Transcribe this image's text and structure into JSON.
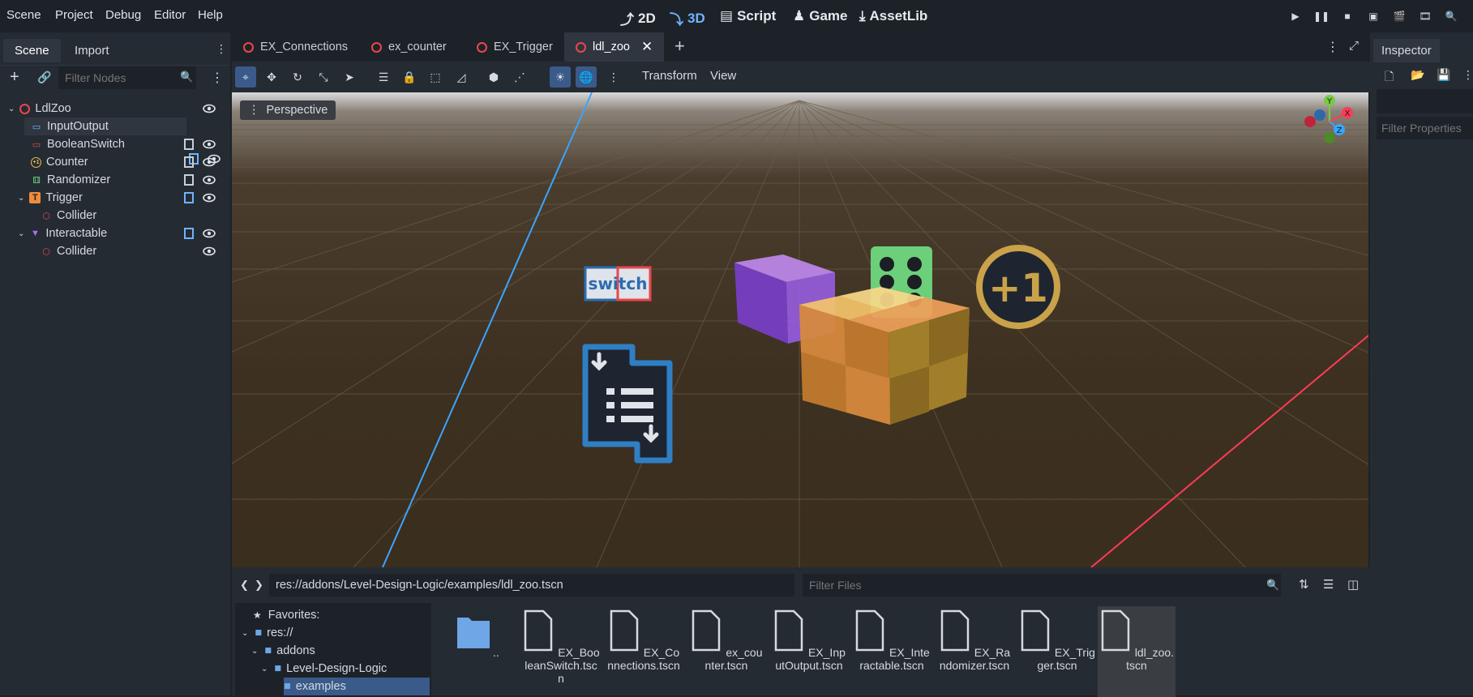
{
  "menu": [
    "Scene",
    "Project",
    "Debug",
    "Editor",
    "Help"
  ],
  "workspaces": [
    {
      "label": "2D",
      "active": false
    },
    {
      "label": "3D",
      "active": true
    },
    {
      "label": "Script",
      "active": false
    },
    {
      "label": "Game",
      "active": false
    },
    {
      "label": "AssetLib",
      "active": false
    }
  ],
  "left_dock": {
    "tabs": [
      "Scene",
      "Import"
    ],
    "filter_placeholder": "Filter Nodes",
    "tree": [
      {
        "label": "LdlZoo",
        "icon": "node3d-icon",
        "color": "#e9474c"
      },
      {
        "label": "InputOutput",
        "icon": "input-output-icon",
        "color": "#6fb4ff"
      },
      {
        "label": "BooleanSwitch",
        "icon": "boolean-switch-icon",
        "color": "#e9474c"
      },
      {
        "label": "Counter",
        "icon": "counter-icon",
        "color": "#e8c14b"
      },
      {
        "label": "Randomizer",
        "icon": "randomizer-icon",
        "color": "#6ccf7a"
      },
      {
        "label": "Trigger",
        "icon": "trigger-icon",
        "color": "#f08b3c"
      },
      {
        "label": "Collider",
        "icon": "collider-icon",
        "color": "#e9474c"
      },
      {
        "label": "Interactable",
        "icon": "interactable-icon",
        "color": "#b46cf0"
      },
      {
        "label": "Collider",
        "icon": "collider-icon",
        "color": "#e9474c"
      }
    ]
  },
  "scene_tabs": [
    "EX_Connections",
    "ex_counter",
    "EX_Trigger",
    "ldl_zoo"
  ],
  "toolbar": {
    "transform_label": "Transform",
    "view_label": "View"
  },
  "viewport": {
    "perspective_label": "Perspective",
    "gizmo_labels": [
      "Y",
      "X",
      "Z"
    ],
    "switch_text": "switch",
    "plus_one_text": "+1"
  },
  "filesystem": {
    "path": "res://addons/Level-Design-Logic/examples/ldl_zoo.tscn",
    "filter_placeholder": "Filter Files",
    "tree": [
      "Favorites:",
      "res://",
      "addons",
      "Level-Design-Logic",
      "examples"
    ],
    "files": [
      {
        "name": ".."
      },
      {
        "name": "EX_BooleanSwitch.tscn"
      },
      {
        "name": "EX_Connections.tscn"
      },
      {
        "name": "ex_counter.tscn"
      },
      {
        "name": "EX_InputOutput.tscn"
      },
      {
        "name": "EX_Interactable.tscn"
      },
      {
        "name": "EX_Randomizer.tscn"
      },
      {
        "name": "EX_Trigger.tscn"
      },
      {
        "name": "ldl_zoo.tscn"
      }
    ]
  },
  "inspector": {
    "tab": "Inspector",
    "filter_placeholder": "Filter Properties"
  }
}
